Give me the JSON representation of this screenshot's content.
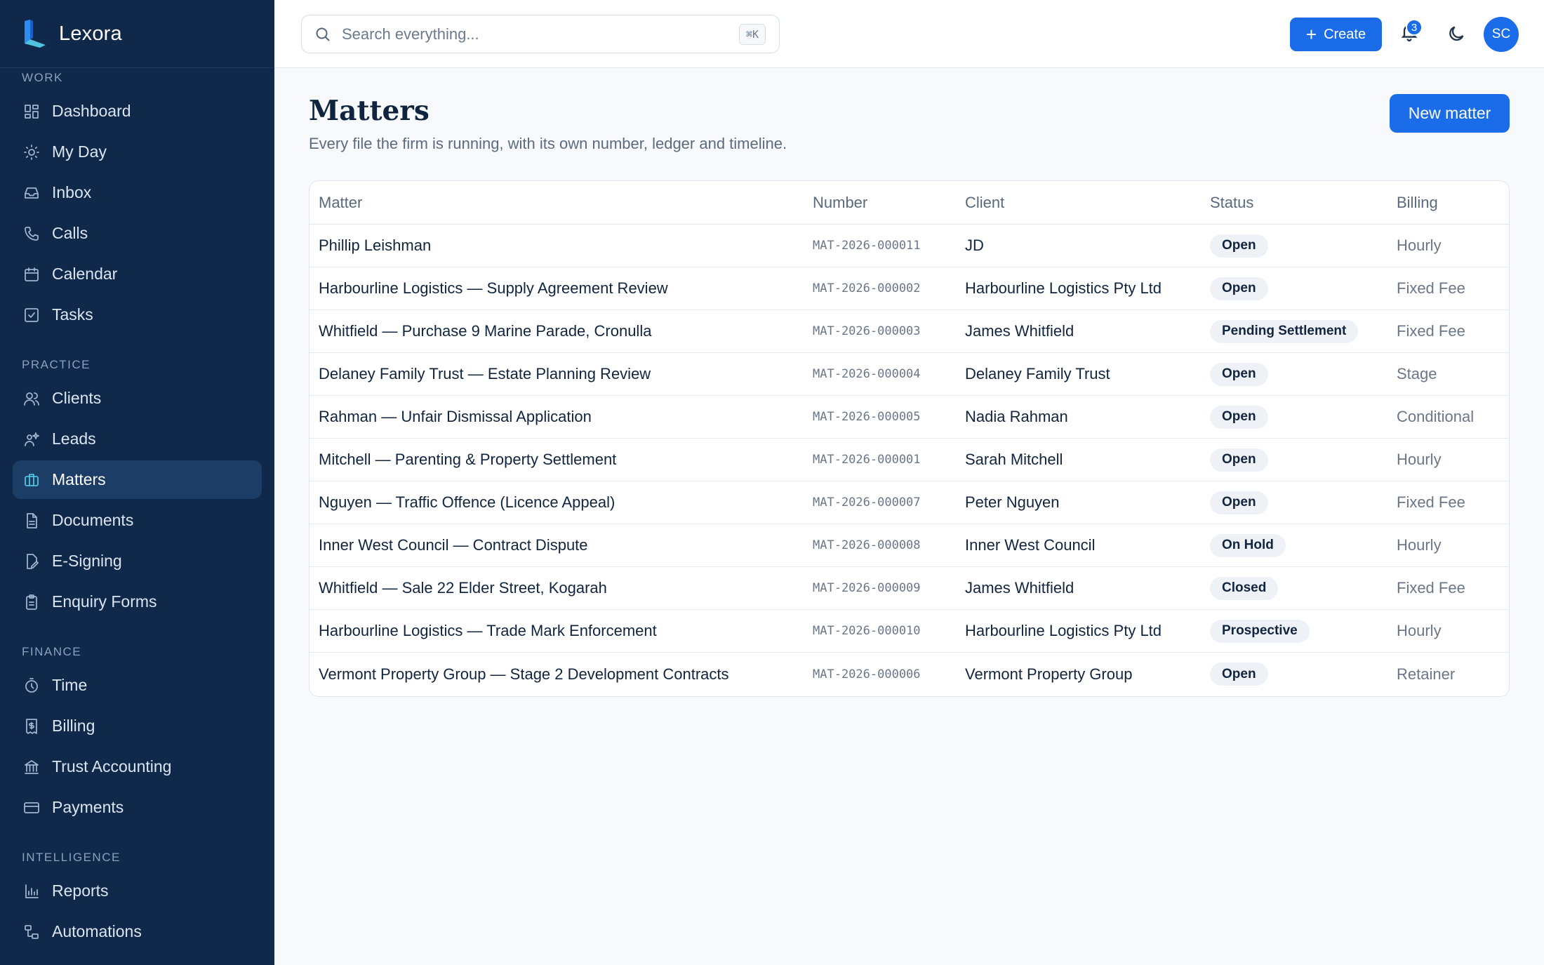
{
  "app": {
    "name": "Lexora"
  },
  "sidebar": {
    "sections": [
      {
        "label": "WORK",
        "items": [
          {
            "label": "Dashboard",
            "icon": "dashboard-icon"
          },
          {
            "label": "My Day",
            "icon": "sun-icon"
          },
          {
            "label": "Inbox",
            "icon": "inbox-icon"
          },
          {
            "label": "Calls",
            "icon": "phone-icon"
          },
          {
            "label": "Calendar",
            "icon": "calendar-icon"
          },
          {
            "label": "Tasks",
            "icon": "checkbox-icon"
          }
        ]
      },
      {
        "label": "PRACTICE",
        "items": [
          {
            "label": "Clients",
            "icon": "users-icon"
          },
          {
            "label": "Leads",
            "icon": "sparkle-user-icon"
          },
          {
            "label": "Matters",
            "icon": "briefcase-icon",
            "active": true
          },
          {
            "label": "Documents",
            "icon": "document-icon"
          },
          {
            "label": "E-Signing",
            "icon": "signature-icon"
          },
          {
            "label": "Enquiry Forms",
            "icon": "clipboard-icon"
          }
        ]
      },
      {
        "label": "FINANCE",
        "items": [
          {
            "label": "Time",
            "icon": "stopwatch-icon"
          },
          {
            "label": "Billing",
            "icon": "invoice-icon"
          },
          {
            "label": "Trust Accounting",
            "icon": "bank-icon"
          },
          {
            "label": "Payments",
            "icon": "card-icon"
          }
        ]
      },
      {
        "label": "INTELLIGENCE",
        "items": [
          {
            "label": "Reports",
            "icon": "bar-chart-icon"
          },
          {
            "label": "Automations",
            "icon": "workflow-icon"
          }
        ]
      }
    ]
  },
  "topbar": {
    "search_placeholder": "Search everything...",
    "search_shortcut": "⌘K",
    "create_label": "Create",
    "notifications_count": "3",
    "avatar_initials": "SC"
  },
  "page": {
    "title": "Matters",
    "subtitle": "Every file the firm is running, with its own number, ledger and timeline.",
    "new_button": "New matter"
  },
  "table": {
    "headers": {
      "matter": "Matter",
      "number": "Number",
      "client": "Client",
      "status": "Status",
      "billing": "Billing"
    },
    "rows": [
      {
        "matter": "Phillip Leishman",
        "number": "MAT-2026-000011",
        "client": "JD",
        "status": "Open",
        "billing": "Hourly"
      },
      {
        "matter": "Harbourline Logistics — Supply Agreement Review",
        "number": "MAT-2026-000002",
        "client": "Harbourline Logistics Pty Ltd",
        "status": "Open",
        "billing": "Fixed Fee"
      },
      {
        "matter": "Whitfield — Purchase 9 Marine Parade, Cronulla",
        "number": "MAT-2026-000003",
        "client": "James Whitfield",
        "status": "Pending Settlement",
        "billing": "Fixed Fee"
      },
      {
        "matter": "Delaney Family Trust — Estate Planning Review",
        "number": "MAT-2026-000004",
        "client": "Delaney Family Trust",
        "status": "Open",
        "billing": "Stage"
      },
      {
        "matter": "Rahman — Unfair Dismissal Application",
        "number": "MAT-2026-000005",
        "client": "Nadia Rahman",
        "status": "Open",
        "billing": "Conditional"
      },
      {
        "matter": "Mitchell — Parenting & Property Settlement",
        "number": "MAT-2026-000001",
        "client": "Sarah Mitchell",
        "status": "Open",
        "billing": "Hourly"
      },
      {
        "matter": "Nguyen — Traffic Offence (Licence Appeal)",
        "number": "MAT-2026-000007",
        "client": "Peter Nguyen",
        "status": "Open",
        "billing": "Fixed Fee"
      },
      {
        "matter": "Inner West Council — Contract Dispute",
        "number": "MAT-2026-000008",
        "client": "Inner West Council",
        "status": "On Hold",
        "billing": "Hourly"
      },
      {
        "matter": "Whitfield — Sale 22 Elder Street, Kogarah",
        "number": "MAT-2026-000009",
        "client": "James Whitfield",
        "status": "Closed",
        "billing": "Fixed Fee"
      },
      {
        "matter": "Harbourline Logistics — Trade Mark Enforcement",
        "number": "MAT-2026-000010",
        "client": "Harbourline Logistics Pty Ltd",
        "status": "Prospective",
        "billing": "Hourly"
      },
      {
        "matter": "Vermont Property Group — Stage 2 Development Contracts",
        "number": "MAT-2026-000006",
        "client": "Vermont Property Group",
        "status": "Open",
        "billing": "Retainer"
      }
    ]
  },
  "colors": {
    "sidebar_bg": "#10294a",
    "accent": "#1a6ce8",
    "active_icon": "#4fc3e0"
  }
}
